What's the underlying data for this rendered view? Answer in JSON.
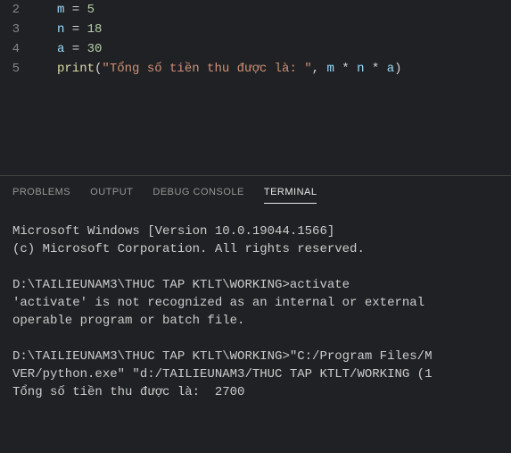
{
  "editor": {
    "lines": [
      {
        "num": "2",
        "tokens": [
          {
            "t": "var",
            "v": "m"
          },
          {
            "t": "op",
            "v": " = "
          },
          {
            "t": "num",
            "v": "5"
          }
        ]
      },
      {
        "num": "3",
        "tokens": [
          {
            "t": "var",
            "v": "n"
          },
          {
            "t": "op",
            "v": " = "
          },
          {
            "t": "num",
            "v": "18"
          }
        ]
      },
      {
        "num": "4",
        "tokens": [
          {
            "t": "var",
            "v": "a"
          },
          {
            "t": "op",
            "v": " = "
          },
          {
            "t": "num",
            "v": "30"
          }
        ]
      },
      {
        "num": "5",
        "tokens": [
          {
            "t": "func",
            "v": "print"
          },
          {
            "t": "paren",
            "v": "("
          },
          {
            "t": "str",
            "v": "\"Tổng số tiền thu được là: \""
          },
          {
            "t": "op",
            "v": ", "
          },
          {
            "t": "var",
            "v": "m"
          },
          {
            "t": "op",
            "v": " * "
          },
          {
            "t": "var",
            "v": "n"
          },
          {
            "t": "op",
            "v": " * "
          },
          {
            "t": "var",
            "v": "a"
          },
          {
            "t": "paren",
            "v": ")"
          }
        ]
      }
    ]
  },
  "panel": {
    "tabs": {
      "problems": "PROBLEMS",
      "output": "OUTPUT",
      "debug": "DEBUG CONSOLE",
      "terminal": "TERMINAL"
    },
    "active": "terminal"
  },
  "terminal": {
    "lines": [
      "Microsoft Windows [Version 10.0.19044.1566]",
      "(c) Microsoft Corporation. All rights reserved.",
      "",
      "D:\\TAILIEUNAM3\\THUC TAP KTLT\\WORKING>activate",
      "'activate' is not recognized as an internal or external ",
      "operable program or batch file.",
      "",
      "D:\\TAILIEUNAM3\\THUC TAP KTLT\\WORKING>\"C:/Program Files/M",
      "VER/python.exe\" \"d:/TAILIEUNAM3/THUC TAP KTLT/WORKING (1",
      "Tổng số tiền thu được là:  2700"
    ]
  }
}
